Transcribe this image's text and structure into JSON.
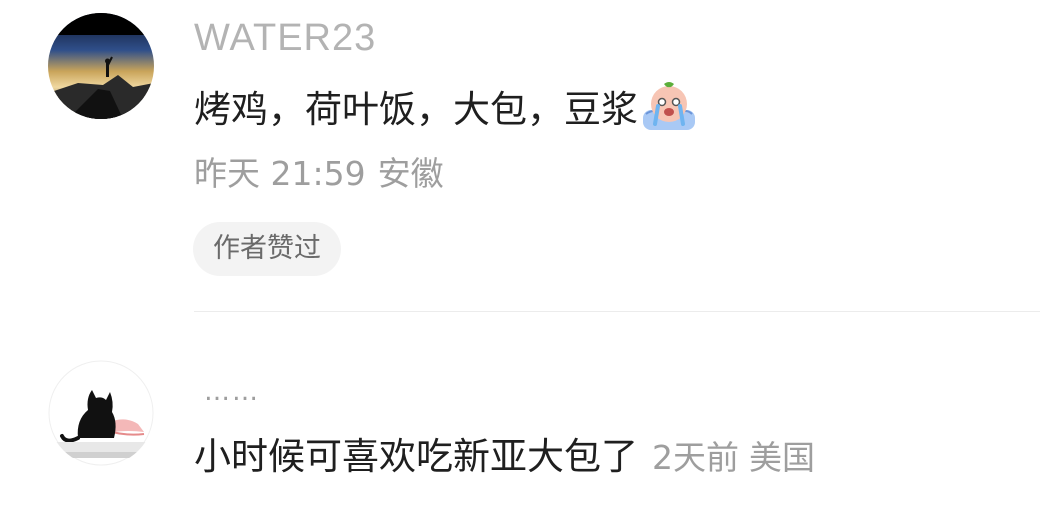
{
  "comments": [
    {
      "username": "WATER23",
      "text": "烤鸡，荷叶饭，大包，豆浆",
      "emoji": "crying-face-emoji",
      "time": "昨天 21:59",
      "location": "安徽",
      "badge": "作者赞过",
      "avatar": "mountain-sunset-avatar"
    },
    {
      "username": "……",
      "text": "小时候可喜欢吃新亚大包了",
      "time": "2天前",
      "location": "美国",
      "avatar": "black-cat-avatar"
    }
  ]
}
